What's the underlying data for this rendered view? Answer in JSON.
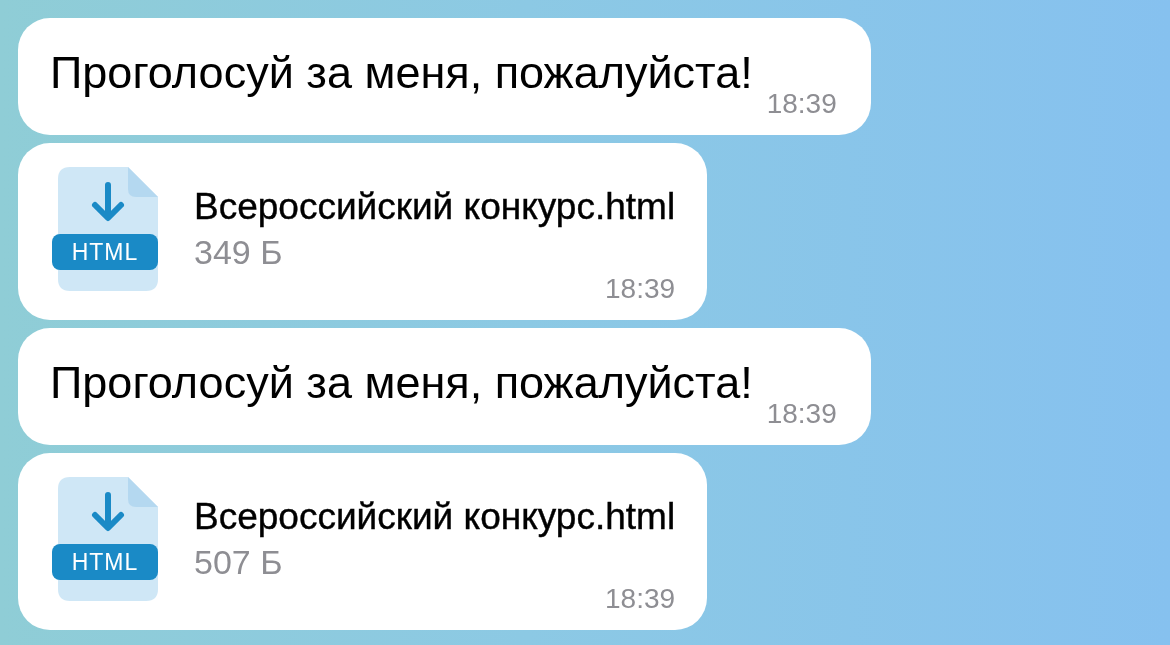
{
  "messages": [
    {
      "kind": "text",
      "text": "Проголосуй за меня, пожалуйста!",
      "time": "18:39"
    },
    {
      "kind": "file",
      "file_name": "Всероссийский конкурс.html",
      "size": "349 Б",
      "badge": "HTML",
      "time": "18:39"
    },
    {
      "kind": "text",
      "text": "Проголосуй за меня, пожалуйста!",
      "time": "18:39"
    },
    {
      "kind": "file",
      "file_name": "Всероссийский конкурс.html",
      "size": "507 Б",
      "badge": "HTML",
      "time": "18:39"
    }
  ]
}
